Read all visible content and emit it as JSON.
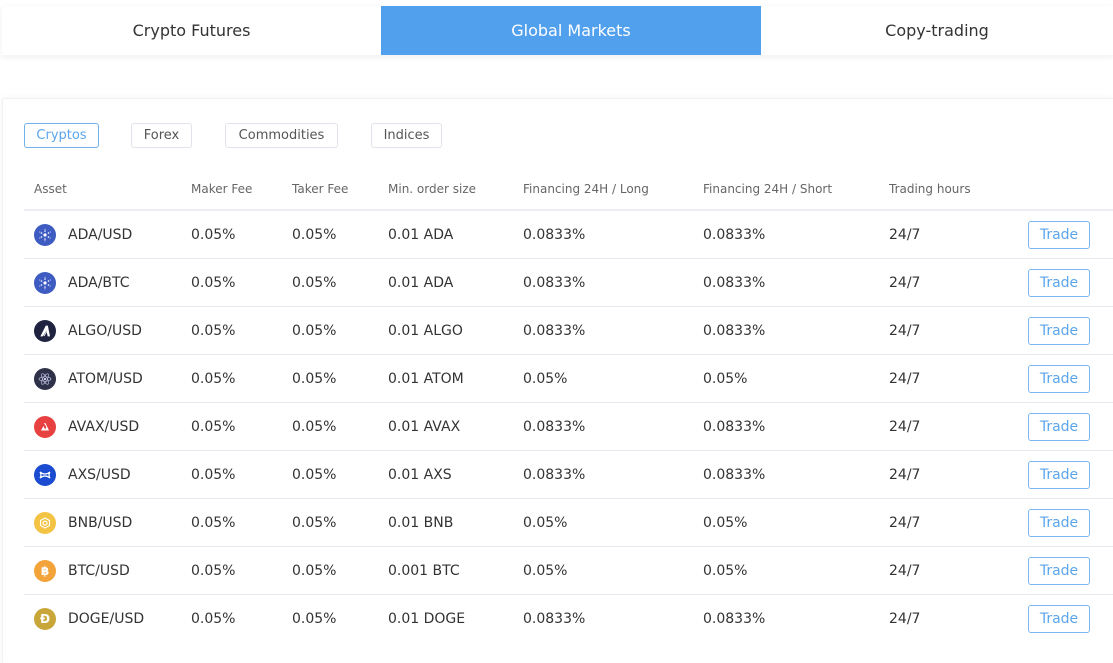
{
  "top_tabs": [
    {
      "label": "Crypto Futures",
      "active": false
    },
    {
      "label": "Global Markets",
      "active": true
    },
    {
      "label": "Copy-trading",
      "active": false
    }
  ],
  "filters": [
    {
      "label": "Cryptos",
      "active": true
    },
    {
      "label": "Forex",
      "active": false
    },
    {
      "label": "Commodities",
      "active": false
    },
    {
      "label": "Indices",
      "active": false
    }
  ],
  "table": {
    "headers": {
      "asset": "Asset",
      "maker_fee": "Maker Fee",
      "taker_fee": "Taker Fee",
      "min_order": "Min. order size",
      "fin_long": "Financing 24H / Long",
      "fin_short": "Financing 24H / Short",
      "hours": "Trading hours"
    },
    "rows": [
      {
        "asset": "ADA/USD",
        "icon": "cardano-icon",
        "color": "#3e5bc2",
        "maker_fee": "0.05%",
        "taker_fee": "0.05%",
        "min_order": "0.01 ADA",
        "fin_long": "0.0833%",
        "fin_short": "0.0833%",
        "hours": "24/7",
        "action": "Trade"
      },
      {
        "asset": "ADA/BTC",
        "icon": "cardano-icon",
        "color": "#3e5bc2",
        "maker_fee": "0.05%",
        "taker_fee": "0.05%",
        "min_order": "0.01 ADA",
        "fin_long": "0.0833%",
        "fin_short": "0.0833%",
        "hours": "24/7",
        "action": "Trade"
      },
      {
        "asset": "ALGO/USD",
        "icon": "algorand-icon",
        "color": "#1f2340",
        "maker_fee": "0.05%",
        "taker_fee": "0.05%",
        "min_order": "0.01 ALGO",
        "fin_long": "0.0833%",
        "fin_short": "0.0833%",
        "hours": "24/7",
        "action": "Trade"
      },
      {
        "asset": "ATOM/USD",
        "icon": "cosmos-icon",
        "color": "#2e3148",
        "maker_fee": "0.05%",
        "taker_fee": "0.05%",
        "min_order": "0.01 ATOM",
        "fin_long": "0.05%",
        "fin_short": "0.05%",
        "hours": "24/7",
        "action": "Trade"
      },
      {
        "asset": "AVAX/USD",
        "icon": "avalanche-icon",
        "color": "#e84142",
        "maker_fee": "0.05%",
        "taker_fee": "0.05%",
        "min_order": "0.01 AVAX",
        "fin_long": "0.0833%",
        "fin_short": "0.0833%",
        "hours": "24/7",
        "action": "Trade"
      },
      {
        "asset": "AXS/USD",
        "icon": "axie-icon",
        "color": "#1a4bd1",
        "maker_fee": "0.05%",
        "taker_fee": "0.05%",
        "min_order": "0.01 AXS",
        "fin_long": "0.0833%",
        "fin_short": "0.0833%",
        "hours": "24/7",
        "action": "Trade"
      },
      {
        "asset": "BNB/USD",
        "icon": "bnb-icon",
        "color": "#f3c344",
        "maker_fee": "0.05%",
        "taker_fee": "0.05%",
        "min_order": "0.01 BNB",
        "fin_long": "0.05%",
        "fin_short": "0.05%",
        "hours": "24/7",
        "action": "Trade"
      },
      {
        "asset": "BTC/USD",
        "icon": "bitcoin-icon",
        "color": "#f2a33a",
        "maker_fee": "0.05%",
        "taker_fee": "0.05%",
        "min_order": "0.001 BTC",
        "fin_long": "0.05%",
        "fin_short": "0.05%",
        "hours": "24/7",
        "action": "Trade"
      },
      {
        "asset": "DOGE/USD",
        "icon": "dogecoin-icon",
        "color": "#c9a63a",
        "maker_fee": "0.05%",
        "taker_fee": "0.05%",
        "min_order": "0.01 DOGE",
        "fin_long": "0.0833%",
        "fin_short": "0.0833%",
        "hours": "24/7",
        "action": "Trade"
      }
    ]
  }
}
